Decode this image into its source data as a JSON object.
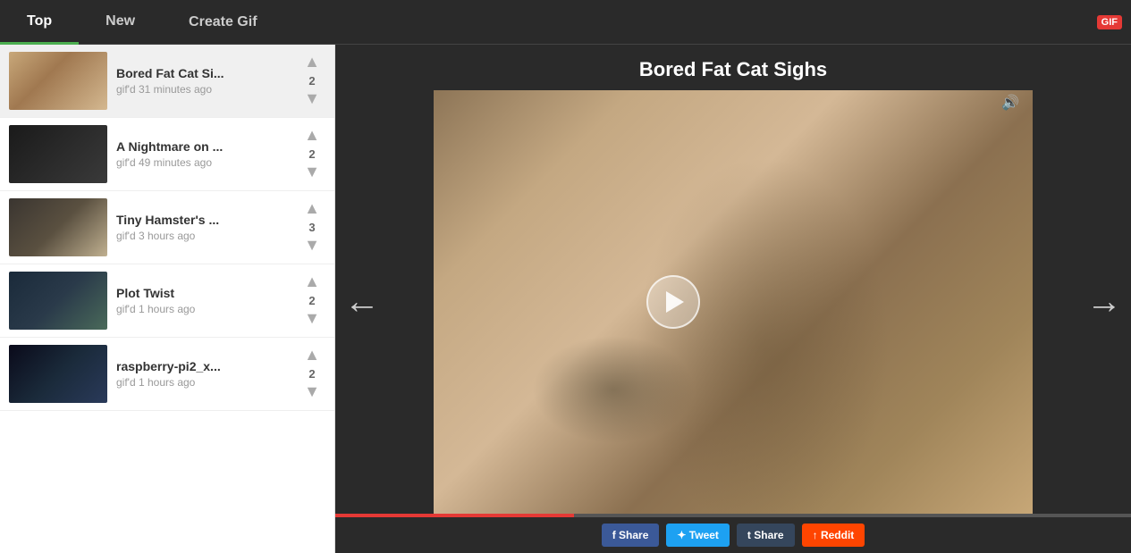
{
  "nav": {
    "tabs": [
      {
        "id": "top",
        "label": "Top",
        "active": true
      },
      {
        "id": "new",
        "label": "New",
        "active": false
      },
      {
        "id": "create",
        "label": "Create Gif",
        "active": false
      }
    ],
    "badge": "GIF"
  },
  "sidebar": {
    "items": [
      {
        "id": 1,
        "title": "Bored Fat Cat Si...",
        "meta": "gif'd 31 minutes ago",
        "votes": 2,
        "thumbClass": "thumb-1",
        "active": true
      },
      {
        "id": 2,
        "title": "A Nightmare on ...",
        "meta": "gif'd 49 minutes ago",
        "votes": 2,
        "thumbClass": "thumb-2",
        "active": false
      },
      {
        "id": 3,
        "title": "Tiny Hamster's ...",
        "meta": "gif'd 3 hours ago",
        "votes": 3,
        "thumbClass": "thumb-3",
        "active": false
      },
      {
        "id": 4,
        "title": "Plot Twist",
        "meta": "gif'd 1 hours ago",
        "votes": 2,
        "thumbClass": "thumb-4",
        "active": false
      },
      {
        "id": 5,
        "title": "raspberry-pi2_x...",
        "meta": "gif'd 1 hours ago",
        "votes": 2,
        "thumbClass": "thumb-5",
        "active": false
      }
    ]
  },
  "main": {
    "title": "Bored Fat Cat Sighs",
    "nav_left": "←",
    "nav_right": "→",
    "volume_icon": "🔊",
    "social_buttons": [
      {
        "id": "fb",
        "label": "f Share",
        "class": "btn-fb"
      },
      {
        "id": "tw",
        "label": "✦ Tweet",
        "class": "btn-tw"
      },
      {
        "id": "tumb",
        "label": "t Share",
        "class": "btn-tumb"
      },
      {
        "id": "reddit",
        "label": "↑ Reddit",
        "class": "btn-reddit"
      }
    ]
  }
}
